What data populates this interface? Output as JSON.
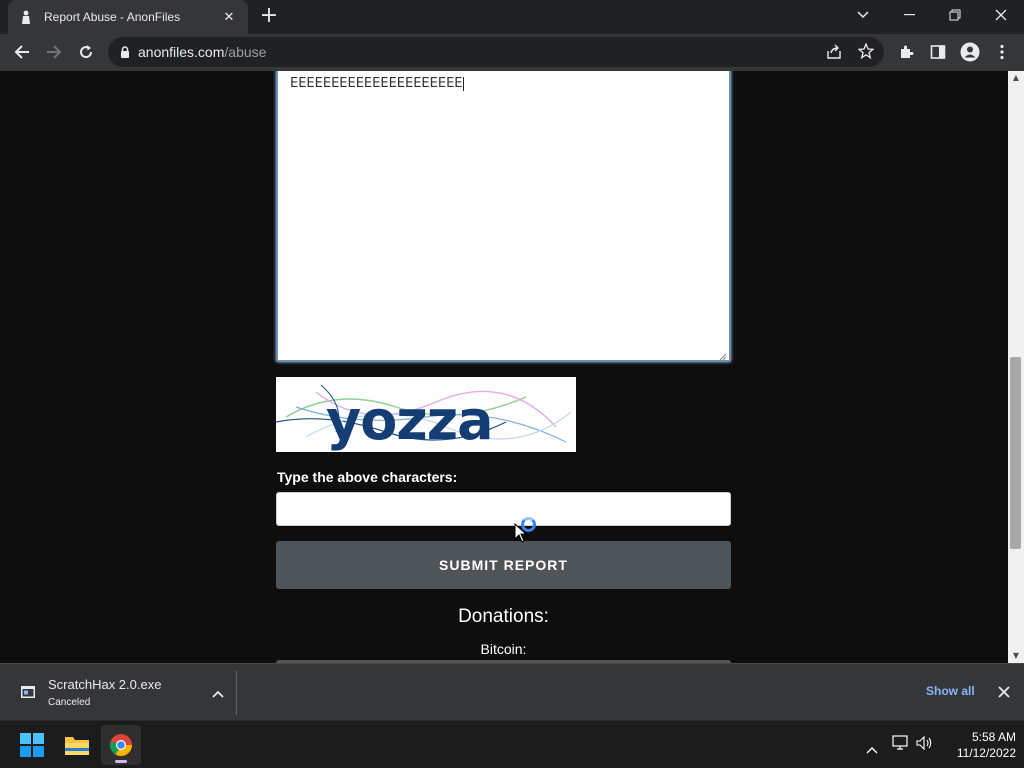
{
  "browser": {
    "tab_title": "Report Abuse - AnonFiles",
    "url_host": "anonfiles.com",
    "url_path": "/abuse"
  },
  "page": {
    "textarea_value": "EEEEEEEEEEEEEEEEEEEEE",
    "captcha_text": "yozza",
    "captcha_label": "Type the above characters:",
    "captcha_input_value": "",
    "submit_label": "SUBMIT REPORT",
    "donations_title": "Donations:",
    "bitcoin_label": "Bitcoin:"
  },
  "download_bar": {
    "file_name": "ScratchHax 2.0.exe",
    "status": "Canceled",
    "show_all_label": "Show all"
  },
  "taskbar": {
    "time": "5:58 AM",
    "date": "11/12/2022"
  },
  "colors": {
    "accent": "#8ab4f8",
    "page_bg": "#0e0e0e",
    "submit_bg": "#4e5457"
  }
}
